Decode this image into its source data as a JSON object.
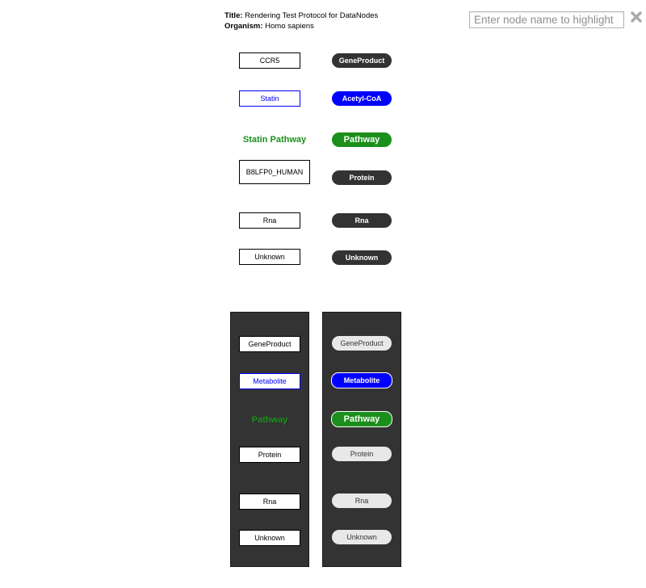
{
  "info": {
    "title_label": "Title:",
    "title": "Rendering Test Protocol for DataNodes",
    "organism_label": "Organism:",
    "organism": "Homo sapiens"
  },
  "search": {
    "placeholder": "Enter node name to highlight"
  },
  "top": {
    "left": [
      "CCR5",
      "Statin",
      "Statin Pathway",
      "B8LFP0_HUMAN",
      "Rna",
      "Unknown"
    ],
    "right": [
      "GeneProduct",
      "Acetyl-CoA",
      "Pathway",
      "Protein",
      "Rna",
      "Unknown"
    ]
  },
  "bottom": {
    "left": [
      "GeneProduct",
      "Metabolite",
      "Pathway",
      "Protein",
      "Rna",
      "Unknown"
    ],
    "right": [
      "GeneProduct",
      "Metabolite",
      "Pathway",
      "Protein",
      "Rna",
      "Unknown"
    ]
  },
  "colors": {
    "dark": "#333333",
    "blue": "#0000ff",
    "green": "#1b8f1b",
    "light": "#e8e8e8"
  }
}
